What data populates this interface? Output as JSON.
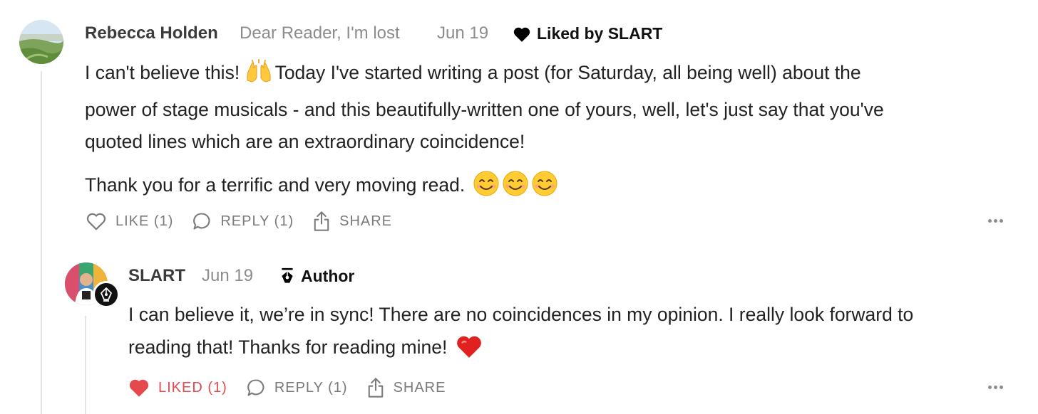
{
  "comment": {
    "author": "Rebecca Holden",
    "publication": "Dear Reader, I'm lost",
    "date": "Jun 19",
    "liked_by": "Liked by SLART",
    "paragraphs": [
      "I can't believe this!",
      "Today I've started writing a post (for Saturday, all being well) about the",
      "power of stage musicals - and this beautifully-written one of yours, well, let's just say that you've",
      "quoted lines which are an extraordinary coincidence!",
      "Thank you for a terrific and very moving read."
    ],
    "actions": {
      "like": "LIKE (1)",
      "reply": "REPLY (1)",
      "share": "SHARE"
    }
  },
  "reply": {
    "author": "SLART",
    "date": "Jun 19",
    "badge": "Author",
    "lines": [
      "I can believe it, we’re in sync! There are no coincidences in my opinion. I really look forward to",
      "reading that! Thanks for reading mine!"
    ],
    "actions": {
      "liked": "LIKED (1)",
      "reply": "REPLY (1)",
      "share": "SHARE"
    }
  },
  "icons": {
    "heart": "heart-icon",
    "comment": "comment-bubble-icon",
    "share": "share-icon",
    "more": "more-dots-icon",
    "pen": "pen-nib-icon"
  },
  "colors": {
    "liked": "#e5484d",
    "muted": "#8c8c8c",
    "thread_line": "#e4e4e4"
  }
}
